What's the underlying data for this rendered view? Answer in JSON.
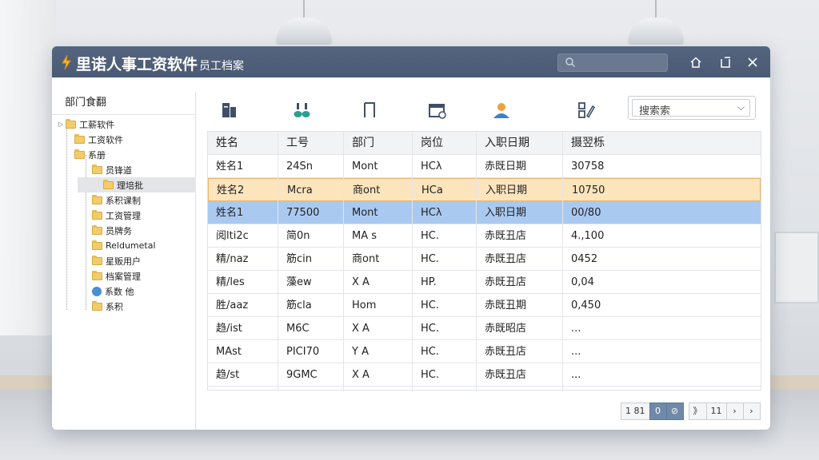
{
  "window": {
    "title": "里诺人事工资软件",
    "subtitle": "员工档案"
  },
  "sidebar": {
    "header": "部门食翻",
    "items": [
      {
        "label": "工薪软件",
        "level": 0,
        "expander": "▷"
      },
      {
        "label": "工资软件",
        "level": 1
      },
      {
        "label": "系册",
        "level": 1
      },
      {
        "label": "员锋道",
        "level": 2
      },
      {
        "label": "理培批",
        "level": 3
      },
      {
        "label": "系积课制",
        "level": 2
      },
      {
        "label": "工资管理",
        "level": 2
      },
      {
        "label": "员牌务",
        "level": 2
      },
      {
        "label": "Reldumetal",
        "level": 2
      },
      {
        "label": "星贩用户",
        "level": 2
      },
      {
        "label": "档案管理",
        "level": 2
      },
      {
        "label": "系数  他",
        "level": 2,
        "icon": "globe-icon"
      },
      {
        "label": "系积",
        "level": 2
      }
    ]
  },
  "toolbar": {
    "icons": [
      "book-icon",
      "bottles-icon",
      "bracket-icon",
      "calendar-icon",
      "person-icon",
      "edit-icon"
    ],
    "dropdown_value": "搜索索",
    "dropdown_icon": "chevron-down-icon"
  },
  "table": {
    "headers": [
      "姓名",
      "工号",
      "部门",
      "岗位",
      "入职日期",
      "摄翌栎"
    ],
    "rows": [
      [
        "姓名1",
        "24Sn",
        "Mont",
        "HCλ",
        "赤既日期",
        "30758"
      ],
      [
        "姓名2",
        "Mcra",
        "商ont",
        "HCa",
        "入职日期",
        "10750"
      ],
      [
        "姓名1",
        "77500",
        "Mont",
        "HCλ",
        "入职日期",
        "00/80"
      ],
      [
        "阅lti2c",
        "简0n",
        "MA s",
        "HC.",
        "赤既丑店",
        "4.,100"
      ],
      [
        "精/naz",
        "筋cin",
        "商ont",
        "HC.",
        "赤既丑店",
        "0452"
      ],
      [
        "精/les",
        "藻ew",
        "X A",
        "HP.",
        "赤既丑店",
        "0,04"
      ],
      [
        "胜/aaz",
        "筋cla",
        "Hom",
        "HC.",
        "赤既丑期",
        "0,450"
      ],
      [
        "趋/ist",
        "M6C",
        "X A",
        "HC.",
        "赤既昭店",
        "..."
      ],
      [
        "MAst",
        "PICI70",
        "Y A",
        "HC.",
        "赤既丑店",
        "..."
      ],
      [
        "趋/st",
        "9GMC",
        "X A",
        "HC.",
        "赤既丑店",
        "..."
      ]
    ]
  },
  "pagination": {
    "items": [
      "1 81",
      "0",
      "⊘",
      "》",
      "11",
      "›",
      "›"
    ],
    "active_index": 1
  },
  "colors": {
    "titlebar": "#4a5a74",
    "highlight_orange": "#fce4bd",
    "highlight_blue": "#a9c9f1"
  }
}
